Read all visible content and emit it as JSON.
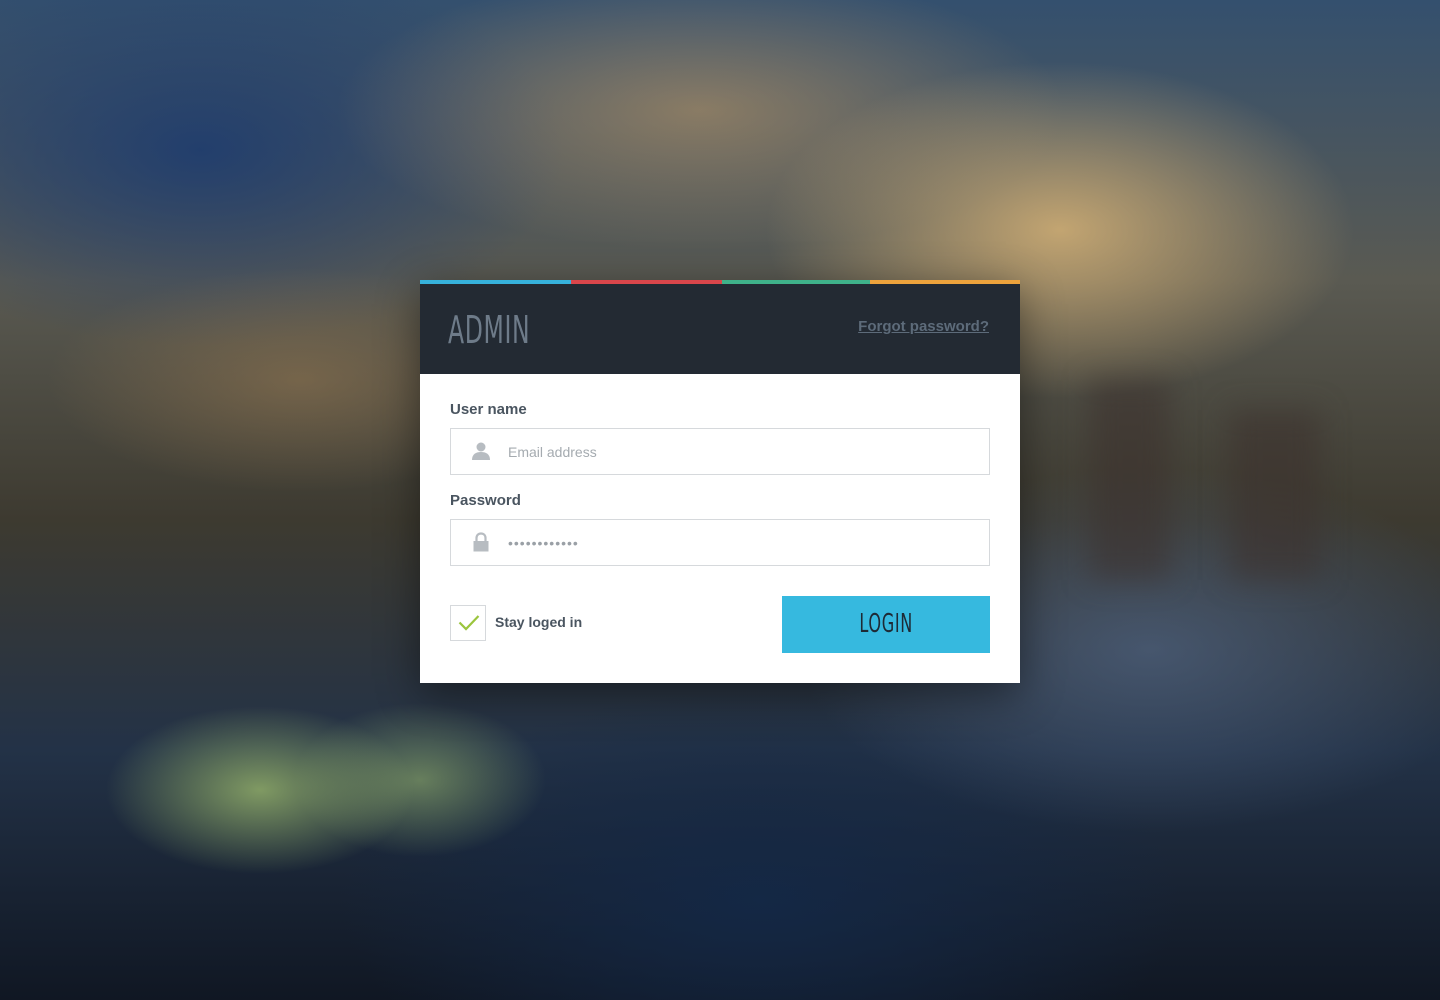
{
  "header": {
    "title": "ADMIN",
    "forgot_label": "Forgot password?"
  },
  "accent_colors": [
    "#36b2dc",
    "#d9464b",
    "#3fb28a",
    "#eda33c"
  ],
  "form": {
    "username": {
      "label": "User name",
      "placeholder": "Email address",
      "icon": "user-icon"
    },
    "password": {
      "label": "Password",
      "value": "••••••••••••",
      "icon": "lock-icon"
    },
    "remember": {
      "label": "Stay loged in",
      "checked": true,
      "icon": "checkmark-icon"
    },
    "login_label": "LOGIN"
  },
  "colors": {
    "header_bg": "#232a33",
    "login_button": "#36b9df",
    "checkmark": "#9bc53d"
  }
}
